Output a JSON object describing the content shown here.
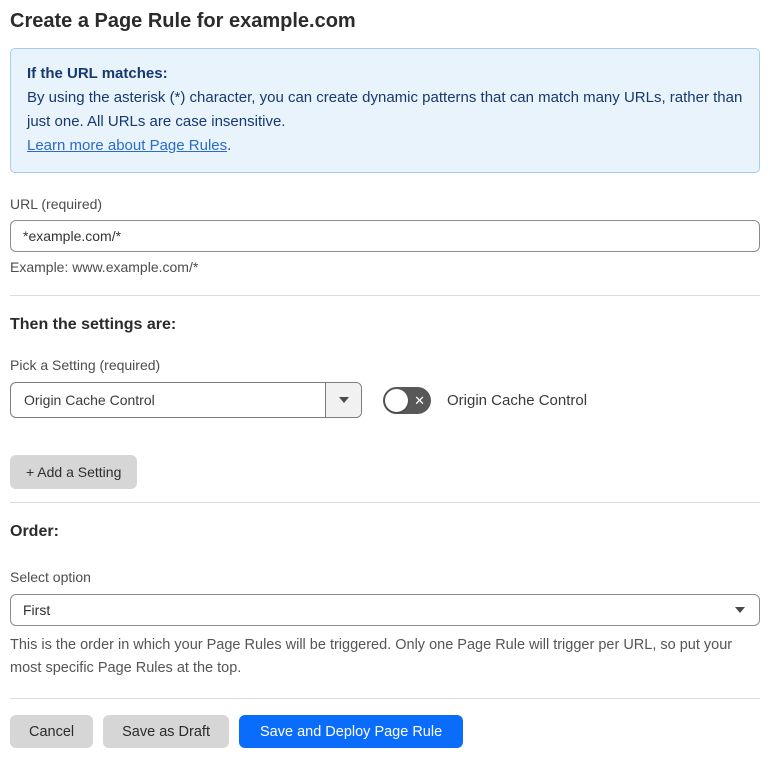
{
  "page": {
    "title": "Create a Page Rule for example.com"
  },
  "info_box": {
    "heading": "If the URL matches:",
    "body": "By using the asterisk (*) character, you can create dynamic patterns that can match many URLs, rather than just one. All URLs are case insensitive.",
    "link_text": "Learn more about Page Rules",
    "link_suffix": "."
  },
  "url_field": {
    "label": "URL (required)",
    "value": "*example.com/*",
    "example": "Example: www.example.com/*"
  },
  "settings_section": {
    "heading": "Then the settings are:",
    "picker_label": "Pick a Setting (required)",
    "picker_value": "Origin Cache Control",
    "toggle_state": "off",
    "toggle_icon_glyph": "✕",
    "toggle_caption": "Origin Cache Control",
    "add_button_label": "+ Add a Setting"
  },
  "order_section": {
    "heading": "Order:",
    "select_label": "Select option",
    "select_value": "First",
    "help_text": "This is the order in which your Page Rules will be triggered. Only one Page Rule will trigger per URL, so put your most specific Page Rules at the top."
  },
  "footer": {
    "cancel_label": "Cancel",
    "save_draft_label": "Save as Draft",
    "save_deploy_label": "Save and Deploy Page Rule"
  },
  "colors": {
    "info_box_background": "#e9f3fc",
    "info_box_border": "#a8cdec",
    "info_text": "#16396f",
    "link_blue": "#2a6bc8",
    "primary_button_blue": "#0a6cfb",
    "toggle_off_gray": "#585858",
    "secondary_button_gray": "#d6d6d6"
  }
}
